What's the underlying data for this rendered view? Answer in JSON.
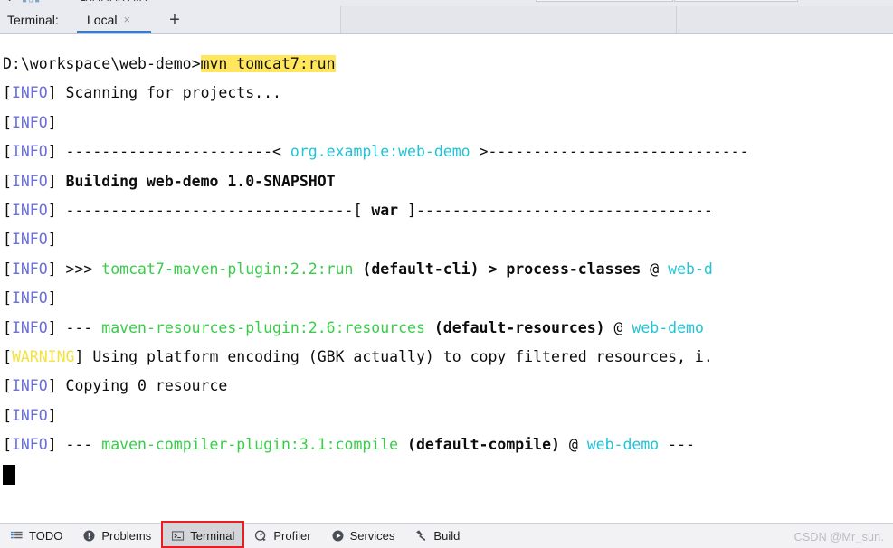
{
  "window": {
    "tabbar": {
      "terminal_label": "Terminal:",
      "active_tab": "Local",
      "close_icon": "×",
      "add_icon": "+"
    }
  },
  "terminal": {
    "prompt": "D:\\workspace\\web-demo>",
    "command": "mvn tomcat7:run",
    "lines": [
      {
        "id": "l1",
        "prefix_open": "[",
        "level": "INFO",
        "prefix_close": "]",
        "text": " Scanning for projects..."
      },
      {
        "id": "l2",
        "prefix_open": "[",
        "level": "INFO",
        "prefix_close": "]",
        "text": ""
      },
      {
        "id": "l3",
        "prefix_open": "[",
        "level": "INFO",
        "prefix_close": "]",
        "dashes_left": " -----------------------< ",
        "coord": "org.example:web-demo",
        "dashes_right": " >-----------------------------"
      },
      {
        "id": "l4",
        "prefix_open": "[",
        "level": "INFO",
        "prefix_close": "]",
        "bold": "Building web-demo 1.0-SNAPSHOT"
      },
      {
        "id": "l5",
        "prefix_open": "[",
        "level": "INFO",
        "prefix_close": "]",
        "dashes_left": " --------------------------------[ ",
        "bold": "war",
        "dashes_right": " ]---------------------------------"
      },
      {
        "id": "l6",
        "prefix_open": "[",
        "level": "INFO",
        "prefix_close": "]",
        "text": ""
      },
      {
        "id": "l7",
        "prefix_open": "[",
        "level": "INFO",
        "prefix_close": "]",
        "marker": " >>> ",
        "plugin": "tomcat7-maven-plugin:2.2:run",
        "exec": " (default-cli) ",
        "chain": "> process-classes ",
        "at": "@ ",
        "artifact": "web-d"
      },
      {
        "id": "l8",
        "prefix_open": "[",
        "level": "INFO",
        "prefix_close": "]",
        "text": ""
      },
      {
        "id": "l9",
        "prefix_open": "[",
        "level": "INFO",
        "prefix_close": "]",
        "marker": " --- ",
        "plugin": "maven-resources-plugin:2.6:resources",
        "exec": " (default-resources) ",
        "at": "@ ",
        "artifact": "web-demo"
      },
      {
        "id": "l10",
        "prefix_open": "[",
        "level": "WARNING",
        "prefix_close": "]",
        "text": " Using platform encoding (GBK actually) to copy filtered resources, i."
      },
      {
        "id": "l11",
        "prefix_open": "[",
        "level": "INFO",
        "prefix_close": "]",
        "text": " Copying 0 resource"
      },
      {
        "id": "l12",
        "prefix_open": "[",
        "level": "INFO",
        "prefix_close": "]",
        "text": ""
      },
      {
        "id": "l13",
        "prefix_open": "[",
        "level": "INFO",
        "prefix_close": "]",
        "marker": " --- ",
        "plugin": "maven-compiler-plugin:3.1:compile",
        "exec": " (default-compile) ",
        "at": "@ ",
        "artifact": "web-demo",
        "trail": " ---"
      }
    ]
  },
  "statusbar": {
    "buttons": [
      {
        "label": "TODO",
        "icon": "todo-list-icon",
        "active": false,
        "annotated": false
      },
      {
        "label": "Problems",
        "icon": "warning-circle-icon",
        "active": false,
        "annotated": false
      },
      {
        "label": "Terminal",
        "icon": "terminal-prompt-icon",
        "active": true,
        "annotated": true
      },
      {
        "label": "Profiler",
        "icon": "profiler-gauge-icon",
        "active": false,
        "annotated": false
      },
      {
        "label": "Services",
        "icon": "play-circle-icon",
        "active": false,
        "annotated": false
      },
      {
        "label": "Build",
        "icon": "hammer-icon",
        "active": false,
        "annotated": false
      }
    ],
    "watermark": "CSDN @Mr_sun."
  },
  "colors": {
    "info": "#6b6fd8",
    "warning": "#f2e13e",
    "coordinate": "#21c3d6",
    "plugin": "#39cc4a",
    "highlight": "#ffe65c",
    "tab_underline": "#3b79c4",
    "annotation": "#ec1c24"
  }
}
